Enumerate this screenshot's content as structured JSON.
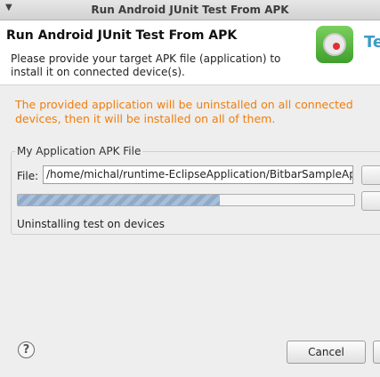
{
  "window": {
    "title": "Run Android JUnit Test From APK",
    "menu_glyph": "▼"
  },
  "header": {
    "title": "Run Android JUnit Test From APK",
    "description": "Please provide your target APK file (application) to install it on connected device(s).",
    "logo_text": "Te",
    "logo_icon": "testdroid-logo-icon"
  },
  "warning": "The provided application will be uninstalled on all connected devices, then it will be installed on all of them.",
  "apk_group": {
    "label": "My Application APK File",
    "file_label": "File:",
    "file_value": "/home/michal/runtime-EclipseApplication/BitbarSampleAp",
    "progress_percent": 60,
    "status": "Uninstalling test on devices"
  },
  "footer": {
    "help_glyph": "?",
    "cancel_label": "Cancel"
  },
  "colors": {
    "warning": "#f07d0a",
    "progress_fill": "#a7bfd9",
    "logo_green": "#5cb940"
  }
}
